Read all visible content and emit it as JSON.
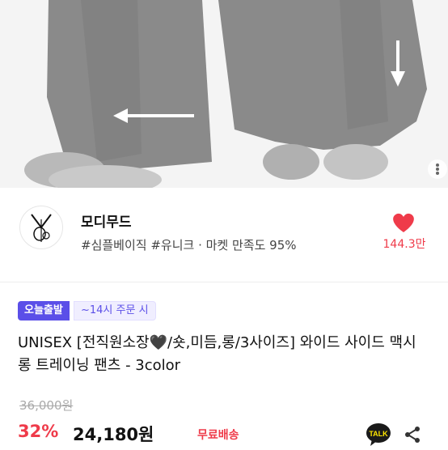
{
  "product": {
    "image_alt": "wide side maxi long training pants photo",
    "title": "UNISEX [전직원소장🖤/숏,미듬,롱/3사이즈]  와이드 사이드 맥시 롱 트레이닝 팬츠 - 3color",
    "badges": {
      "delivery": "오늘출발",
      "order_time": "~14시 주문 시"
    },
    "original_price": "36,000원",
    "discount": "32%",
    "price": "24,180원",
    "shipping": "무료배송"
  },
  "store": {
    "name": "모디무드",
    "tags": "#심플베이직 #유니크 · 마켓 만족도 95%",
    "likes": "144.3만"
  },
  "colors": {
    "accent": "#ef3b4a",
    "badge": "#5b4fe8",
    "kakao": "#fee500"
  },
  "icons": {
    "like": "heart-icon",
    "chat": "kakao-talk-icon",
    "share": "share-icon",
    "more": "more-dots-icon"
  }
}
